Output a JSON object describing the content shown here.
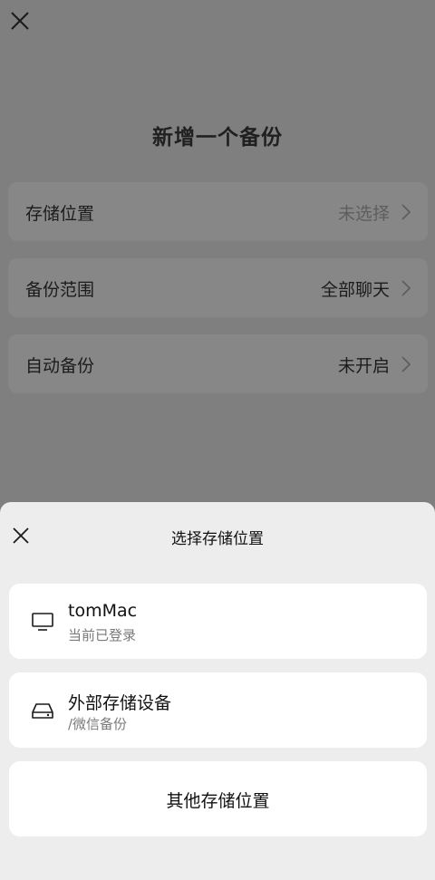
{
  "header": {
    "title": "新增一个备份"
  },
  "icons": {
    "close": "close-icon",
    "chevron": "chevron-right-icon",
    "monitor": "monitor-icon",
    "drive": "drive-icon"
  },
  "settings": [
    {
      "label": "存储位置",
      "value": "未选择"
    },
    {
      "label": "备份范围",
      "value": "全部聊天"
    },
    {
      "label": "自动备份",
      "value": "未开启"
    }
  ],
  "sheet": {
    "title": "选择存储位置",
    "options": [
      {
        "title": "tomMac",
        "subtitle": "当前已登录"
      },
      {
        "title": "外部存储设备",
        "subtitle": "/微信备份"
      }
    ],
    "other_label": "其他存储位置"
  },
  "colors": {
    "overlay": "#7f7f7f",
    "sheet_bg": "#ededed",
    "card_bg": "#ffffff"
  }
}
